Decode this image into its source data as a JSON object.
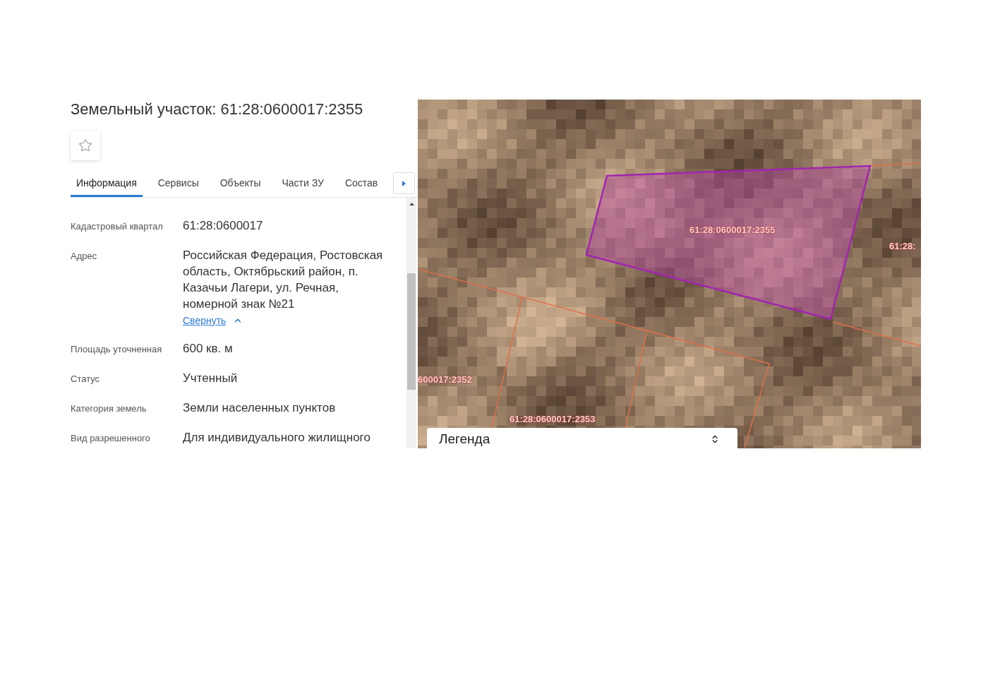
{
  "title": "Земельный участок: 61:28:0600017:2355",
  "favorite": {
    "checked": false
  },
  "tabs": [
    {
      "label": "Информация",
      "selected": true
    },
    {
      "label": "Сервисы",
      "selected": false
    },
    {
      "label": "Объекты",
      "selected": false
    },
    {
      "label": "Части ЗУ",
      "selected": false
    },
    {
      "label": "Состав",
      "selected": false
    }
  ],
  "info_rows": [
    {
      "label": "Кадастровый квартал",
      "value": "61:28:0600017"
    },
    {
      "label": "Адрес",
      "value": "Российская Федерация, Ростовская область, Октябрьский район, п. Казачьи Лагери, ул. Речная, номерной знак №21",
      "toggle": {
        "label": "Свернуть",
        "expanded": true
      }
    },
    {
      "label": "Площадь уточненная",
      "value": "600 кв. м"
    },
    {
      "label": "Статус",
      "value": "Учтенный"
    },
    {
      "label": "Категория земель",
      "value": "Земли населенных пунктов"
    },
    {
      "label": "Вид разрешенного",
      "value": "Для индивидуального жилищного"
    }
  ],
  "map": {
    "parcel_labels": [
      {
        "text": "61:28:0600017:2355"
      },
      {
        "text": "61:28:"
      },
      {
        "text": "600017:2352"
      },
      {
        "text": "61:28:0600017:2353"
      }
    ],
    "legend": {
      "title": "Легенда"
    }
  }
}
